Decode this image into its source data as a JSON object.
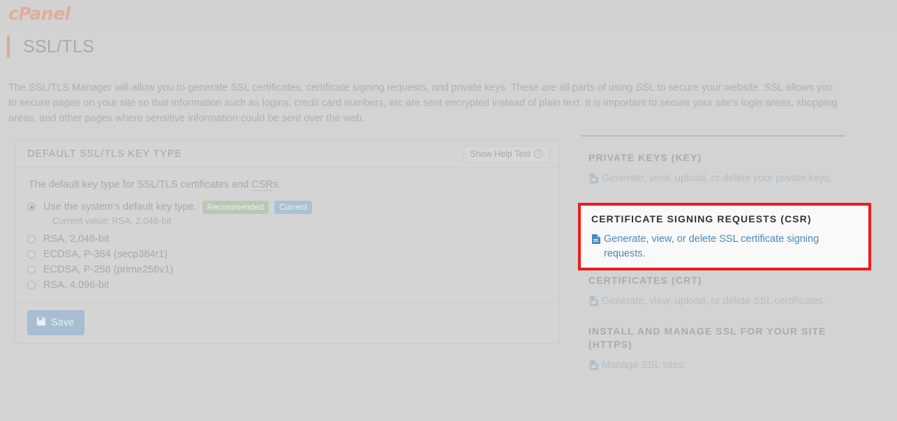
{
  "brand": {
    "logo_text": "cPanel",
    "logo_color": "#e2ab9c"
  },
  "page": {
    "title": "SSL/TLS",
    "accent_color": "#dfa795",
    "description": "The SSL/TLS Manager will allow you to generate SSL certificates, certificate signing requests, and private keys. These are all parts of using SSL to secure your website. SSL allows you to secure pages on your site so that information such as logins, credit card numbers, etc are sent encrypted instead of plain text. It is important to secure your site's login areas, shopping areas, and other pages where sensitive information could be sent over the web."
  },
  "key_type_card": {
    "heading": "DEFAULT SSL/TLS KEY TYPE",
    "help_button": {
      "label": "Show Help Text",
      "icon": "question-circle-icon"
    },
    "lead_prefix": "The default key type for SSL/TLS certificates and ",
    "lead_abbr": "CSR",
    "lead_suffix": "s.",
    "options": [
      {
        "label": "Use the system's default key type.",
        "checked": true,
        "badges": [
          {
            "text": "Recommended",
            "color": "#bac8b2"
          },
          {
            "text": "Current",
            "color": "#a7c3d4"
          }
        ],
        "subnote": "Current value: RSA, 2,048-bit"
      },
      {
        "label": "RSA, 2,048-bit",
        "checked": false
      },
      {
        "label": "ECDSA, P-384 (secp384r1)",
        "checked": false
      },
      {
        "label": "ECDSA, P-256 (prime256v1)",
        "checked": false
      },
      {
        "label": "RSA, 4,096-bit",
        "checked": false
      }
    ],
    "save_button": {
      "label": "Save",
      "icon": "save-disk-icon",
      "color": "#a7bdd2"
    }
  },
  "side_panel": {
    "sections": [
      {
        "heading": "PRIVATE KEYS (KEY)",
        "link": "Generate, view, upload, or delete your private keys.",
        "icon": "document-icon",
        "highlighted": false
      },
      {
        "heading": "CERTIFICATE SIGNING REQUESTS (CSR)",
        "link": "Generate, view, or delete SSL certificate signing requests.",
        "icon": "document-icon",
        "highlighted": true,
        "highlight_color": "#ec1c1c"
      },
      {
        "heading": "CERTIFICATES (CRT)",
        "link": "Generate, view, upload, or delete SSL certificates.",
        "icon": "document-icon",
        "highlighted": false
      },
      {
        "heading": "INSTALL AND MANAGE SSL FOR YOUR SITE (HTTPS)",
        "link": "Manage SSL sites.",
        "icon": "document-icon",
        "highlighted": false
      }
    ]
  }
}
